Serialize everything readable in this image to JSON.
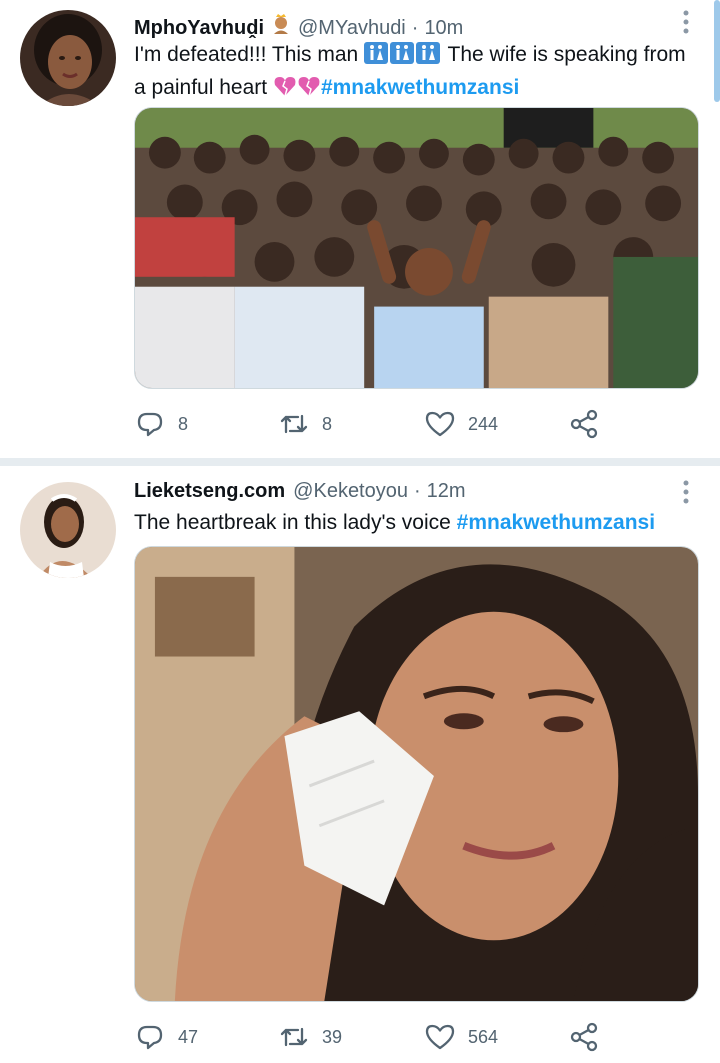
{
  "tweets": [
    {
      "display_name": "MphoYavhuḓi",
      "name_emoji": "woman-with-crown-emoji",
      "handle": "@MYavhudi",
      "separator": "·",
      "time": "10m",
      "text_part1": "I'm defeated!!! This man ",
      "text_emoji1": "toilet-sign-emojis",
      "text_part2": " The wife is speaking from a painful heart ",
      "text_emoji2": "broken-hearts-emoji",
      "hashtag": "#mnakwethumzansi",
      "media": "photo-crowd-hands-on-heads",
      "reply_count": "8",
      "retweet_count": "8",
      "like_count": "244"
    },
    {
      "display_name": "Lieketseng.com",
      "handle": "@Keketoyou",
      "separator": "·",
      "time": "12m",
      "text_part1": "The heartbreak in this lady's voice ",
      "hashtag": "#mnakwethumzansi",
      "media": "photo-woman-crying-tissue",
      "reply_count": "47",
      "retweet_count": "39",
      "like_count": "564"
    }
  ],
  "icons": {
    "reply": "reply-icon",
    "retweet": "retweet-icon",
    "like": "heart-icon",
    "share": "share-icon",
    "more": "more-vertical-icon"
  },
  "colors": {
    "hashtag": "#1d9bf0",
    "secondary_text": "#536471",
    "divider": "#e6ecf0"
  }
}
